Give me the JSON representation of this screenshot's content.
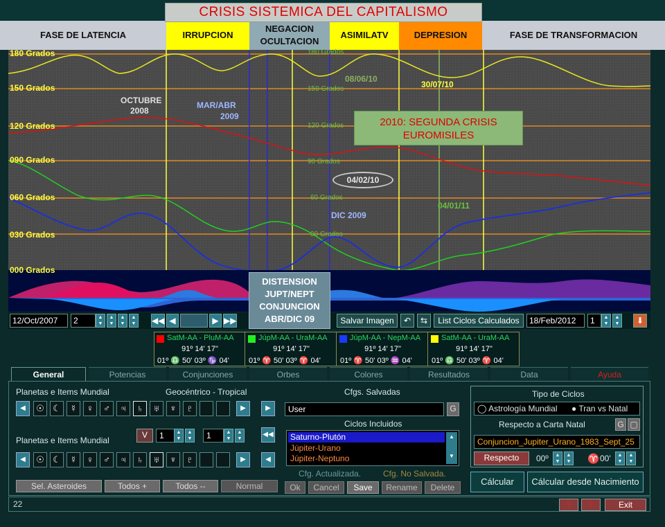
{
  "title": "CRISIS SISTEMICA DEL CAPITALISMO",
  "phases": [
    {
      "label": "FASE DE LATENCIA",
      "color": "#c8ccd4"
    },
    {
      "label": "IRRUPCION",
      "color": "#ffff00"
    },
    {
      "label": "NEGACION OCULTACION",
      "color": "#90aab4"
    },
    {
      "label": "ASIMILATV",
      "color": "#ffff00"
    },
    {
      "label": "DEPRESION",
      "color": "#ff8a00"
    },
    {
      "label": "FASE DE TRANSFORMACION",
      "color": "#c8ccd4"
    }
  ],
  "chart": {
    "grado_labels": [
      "180 Grados",
      "150 Grados",
      "120 Grados",
      "090 Grados",
      "060 Grados",
      "030 Grados",
      "000 Grados"
    ],
    "inner_labels": [
      "180 Grados",
      "150 Grados",
      "120 Grados",
      "90 Grados",
      "60 Grados",
      "30 Grados"
    ],
    "annotations": {
      "octubre": "OCTUBRE",
      "year2008": "2008",
      "marabr": "MAR/ABR",
      "year2009": "2009",
      "date1": "08/06/10",
      "date2": "30/07/10",
      "date3": "04/02/10",
      "date4": "04/01/11",
      "dic": "DIC 2009",
      "crisis_line1": "2010: SEGUNDA CRISIS",
      "crisis_line2": "EUROMISILES",
      "distension": [
        "DISTENSION",
        "JUPT/NEPT",
        "CONJUNCION",
        "ABR/DIC 09"
      ]
    }
  },
  "toolbar": {
    "start_date": "12/Oct/2007",
    "step": "2",
    "save_image": "Salvar Imagen",
    "list_cycles": "List Ciclos Calculados",
    "end_date": "18/Feb/2012",
    "count": "1"
  },
  "legend": [
    {
      "name": "SatM-AA - PluM-AA",
      "color": "#ff0000",
      "deg": "91º 14' 17\"",
      "pos": "01º ♎ 50'  03º ♑ 04'"
    },
    {
      "name": "JúpM-AA - UraM-AA",
      "color": "#22ee22",
      "deg": "91º 14' 17\"",
      "pos": "01º ♈ 50'  03º ♈ 04'"
    },
    {
      "name": "JúpM-AA - NepM-AA",
      "color": "#1a3aff",
      "deg": "91º 14' 17\"",
      "pos": "01º ♈ 50'  03º ♒ 04'"
    },
    {
      "name": "SatM-AA - UraM-AA",
      "color": "#ffff00",
      "deg": "91º 14' 17\"",
      "pos": "01º ♎ 50'  03º ♈ 04'"
    }
  ],
  "tabs": [
    "General",
    "Potencias",
    "Conjunciones",
    "Orbes",
    "Colores",
    "Resultados",
    "Data",
    "Ayuda"
  ],
  "general": {
    "planets_label1": "Planetas e Items Mundial",
    "geocentric": "Geocéntrico - Tropical",
    "planets_label2": "Planetas e Items Mundial",
    "planet_glyphs": [
      "☉",
      "☾",
      "☿",
      "♀",
      "♂",
      "♃",
      "♄",
      "♅",
      "♆",
      "♇",
      "",
      ""
    ],
    "v_btn": "V",
    "spin1": "1",
    "spin2": "1",
    "sel_asteroides": "Sel. Asteroides",
    "todos_plus": "Todos +",
    "todos_minus": "Todos --",
    "normal": "Normal"
  },
  "cfg": {
    "saved_label": "Cfgs. Salvadas",
    "user": "User",
    "g_btn": "G",
    "included_label": "Ciclos Incluidos",
    "items": [
      "Saturno-Plutón",
      "Júpiter-Urano",
      "Júpiter-Neptuno"
    ],
    "updated": "Cfg. Actualizada.",
    "not_saved": "Cfg. No Salvada.",
    "ok": "Ok",
    "cancel": "Cancel",
    "save": "Save",
    "rename": "Rename",
    "delete": "Delete"
  },
  "tipo": {
    "title": "Tipo de Ciclos",
    "opt1": "Astrología Mundial",
    "opt2": "Tran vs Natal",
    "respecto": "Respecto a Carta Natal",
    "carta": "Conjuncion_Jupiter_Urano_1983_Sept_25",
    "respecto_btn": "Respecto",
    "deg1": "00º",
    "aries": "♈",
    "deg2": "00'",
    "calcular": "Cálcular",
    "calcular_nac": "Cálcular desde Nacimiento"
  },
  "status": {
    "value": "22",
    "exit": "Exit",
    "q": "?"
  }
}
